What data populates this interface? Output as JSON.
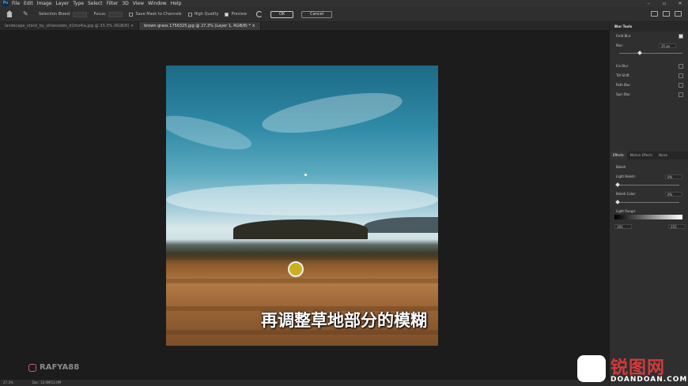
{
  "menubar": {
    "logo": "Ps",
    "items": [
      "File",
      "Edit",
      "Image",
      "Layer",
      "Type",
      "Select",
      "Filter",
      "3D",
      "View",
      "Window",
      "Help"
    ],
    "window_controls": [
      "–",
      "▫",
      "✕"
    ]
  },
  "options": {
    "selection_bleed": "Selection Bleed:",
    "focus": "Focus:",
    "save_mask": "Save Mask to Channels",
    "high_quality": "High Quality",
    "preview": "Preview",
    "ok": "OK",
    "cancel": "Cancel"
  },
  "tabs": [
    {
      "label": "landscape_stock_by_stilwoodes_d1mz4ia.jpg @ 33.3% (RGB/8) ×",
      "active": false
    },
    {
      "label": "brown grass 1756325.jpg @ 27.3% (Layer 1, RGB/8) * ×",
      "active": true
    }
  ],
  "canvas": {
    "subtitle": "再调整草地部分的模糊",
    "watermark_left": "RAFYA88"
  },
  "status": {
    "zoom": "27.3%",
    "doc": "Doc: 12.0M/12.0M"
  },
  "blur_tools": {
    "title": "Blur Tools",
    "field_blur": "Field Blur",
    "blur_label": "Blur:",
    "blur_value": "35 px",
    "blur_fraction": 0.3,
    "others": [
      "Iris Blur",
      "Tilt-Shift",
      "Path Blur",
      "Spin Blur"
    ]
  },
  "effects": {
    "tabs": [
      "Effects",
      "Motion Effects",
      "Noise"
    ],
    "bokeh": "Bokeh",
    "light_bokeh": "Light Bokeh:",
    "light_bokeh_value": "0%",
    "bokeh_color": "Bokeh Color:",
    "bokeh_color_value": "0%",
    "light_range": "Light Range:",
    "range_low": "191",
    "range_high": "255"
  },
  "watermark_right": {
    "cn": "锐图网",
    "en": "DOANDOAN.COM"
  }
}
